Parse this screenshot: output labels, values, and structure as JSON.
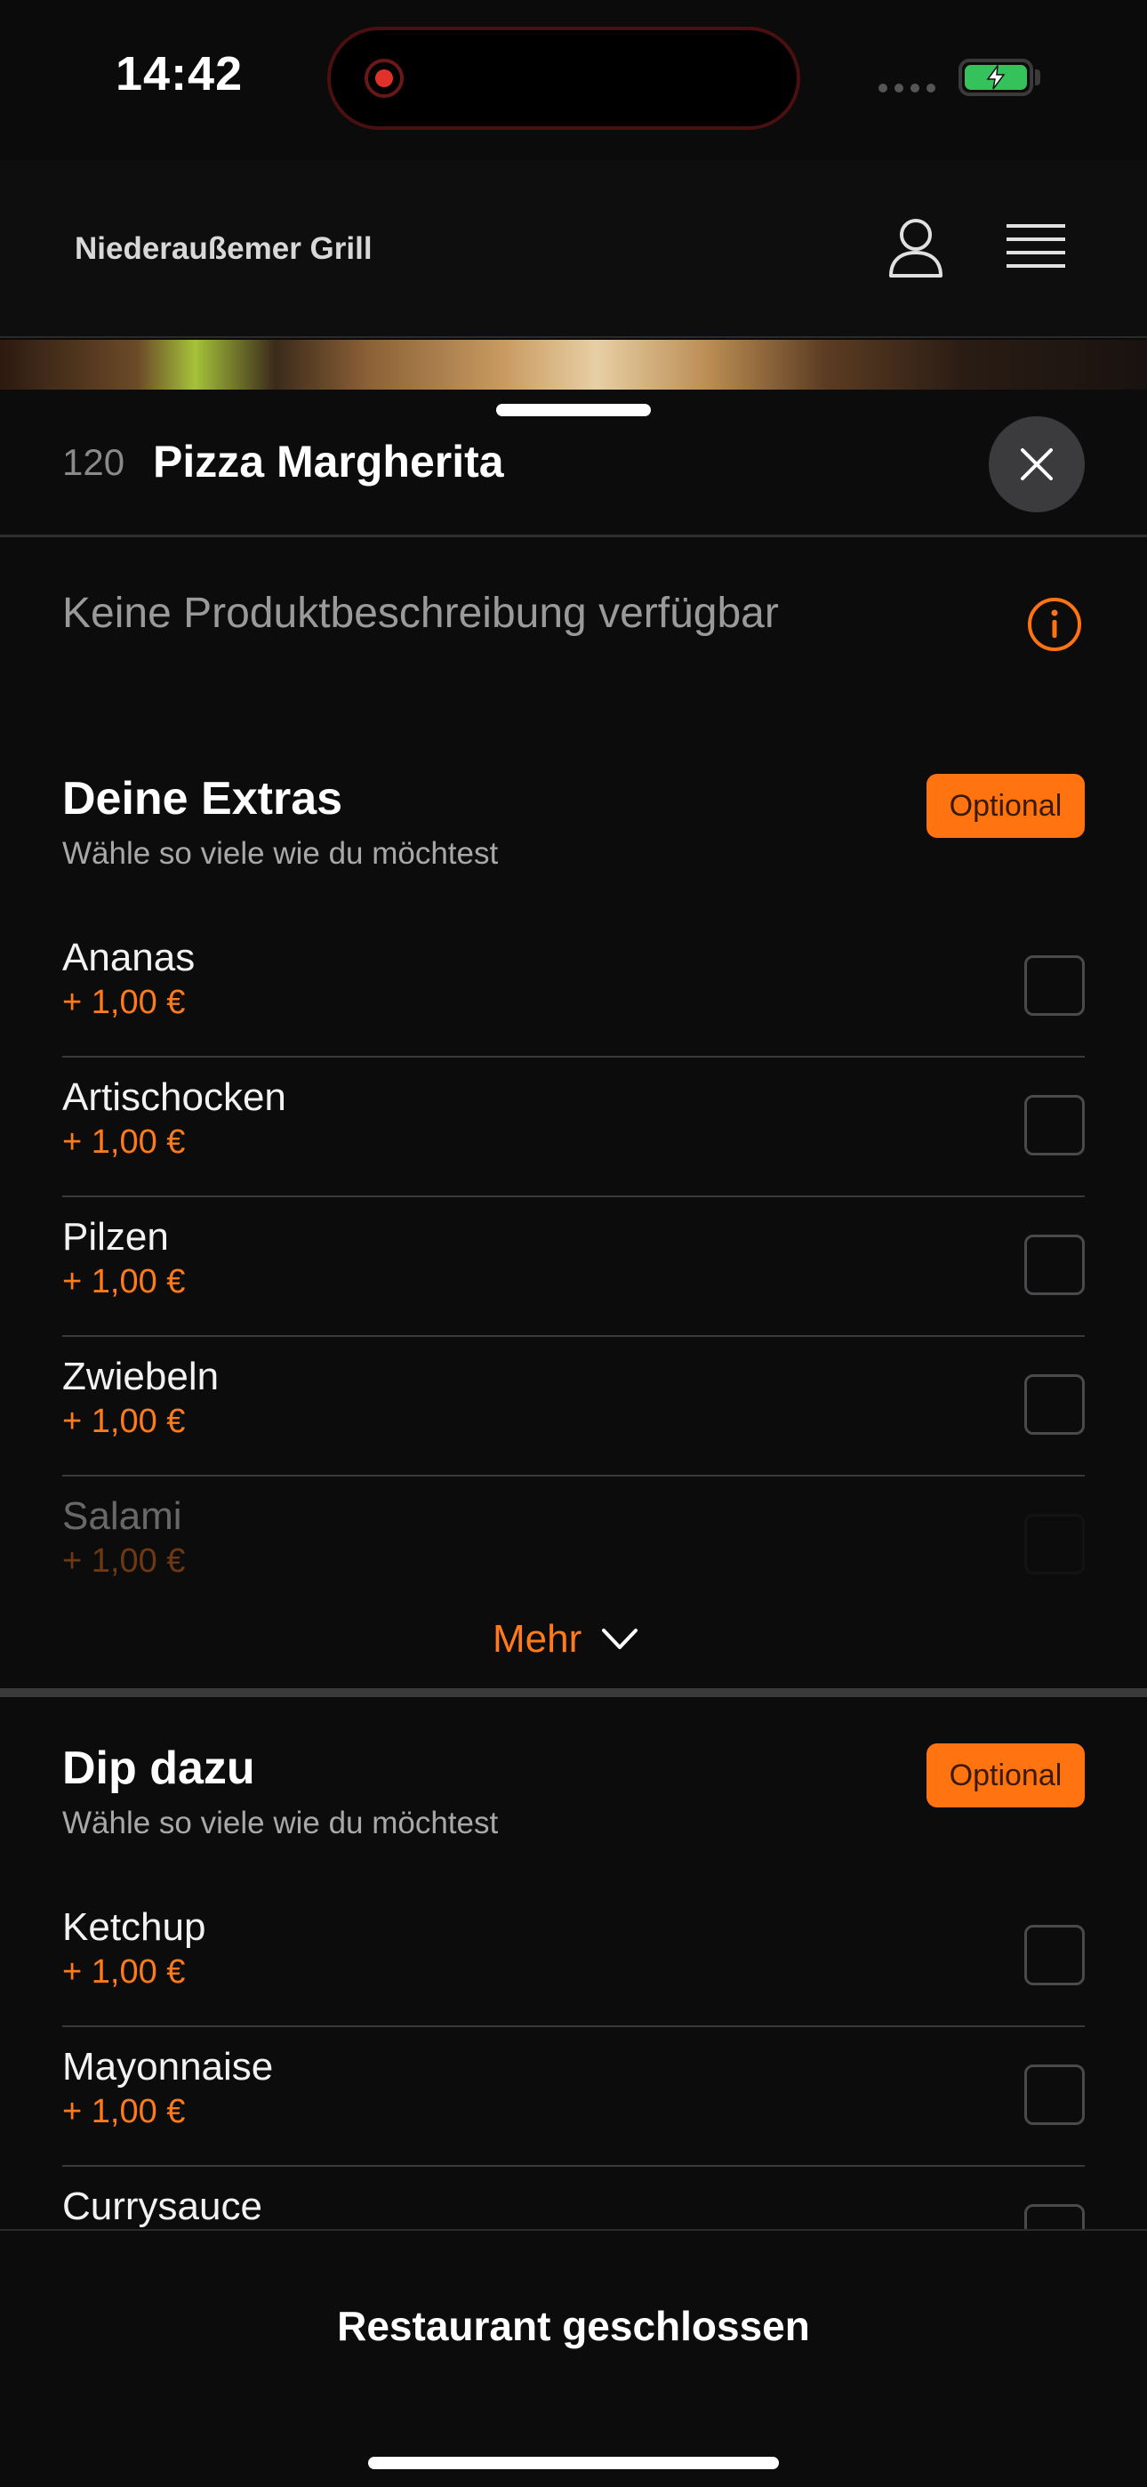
{
  "status_bar": {
    "time": "14:42",
    "battery_icon": "battery-charging-icon"
  },
  "header": {
    "restaurant_name": "Niederaußemer Grill",
    "profile_icon": "user-icon",
    "menu_icon": "menu-icon"
  },
  "product": {
    "number": "120",
    "name": "Pizza Margherita",
    "description": "Keine Produktbeschreibung verfügbar"
  },
  "groups": [
    {
      "title": "Deine Extras",
      "subtitle": "Wähle so viele wie du möchtest",
      "badge": "Optional",
      "options": [
        {
          "name": "Ananas",
          "price": "+ 1,00 €",
          "checked": false
        },
        {
          "name": "Artischocken",
          "price": "+ 1,00 €",
          "checked": false
        },
        {
          "name": "Pilzen",
          "price": "+ 1,00 €",
          "checked": false
        },
        {
          "name": "Zwiebeln",
          "price": "+ 1,00 €",
          "checked": false
        },
        {
          "name": "Salami",
          "price": "+ 1,00 €",
          "checked": false
        }
      ],
      "more_label": "Mehr"
    },
    {
      "title": "Dip dazu",
      "subtitle": "Wähle so viele wie du möchtest",
      "badge": "Optional",
      "options": [
        {
          "name": "Ketchup",
          "price": "+ 1,00 €",
          "checked": false
        },
        {
          "name": "Mayonnaise",
          "price": "+ 1,00 €",
          "checked": false
        },
        {
          "name": "Currysauce",
          "price": "",
          "checked": false
        }
      ]
    }
  ],
  "footer": {
    "status": "Restaurant geschlossen"
  },
  "colors": {
    "accent": "#ff7410",
    "background": "#0c0c0d",
    "battery": "#36c25a"
  }
}
